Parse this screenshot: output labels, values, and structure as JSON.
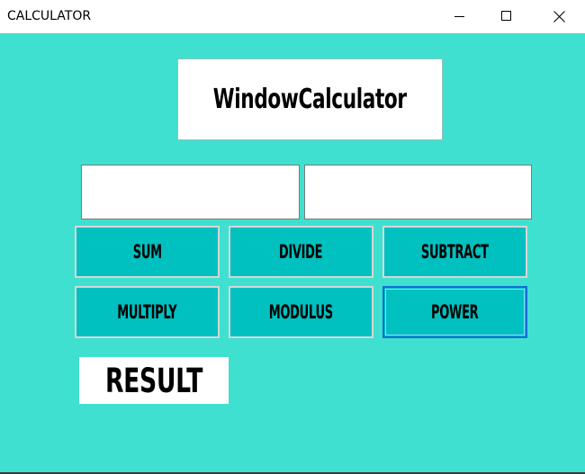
{
  "window": {
    "title": "CALCULATOR",
    "controls": [
      "minimize-icon",
      "maximize-icon",
      "close-icon"
    ]
  },
  "colors": {
    "client_background": "#40e0d0",
    "button_background": "#00c0c0",
    "button_border": "#d6d6d6",
    "focus_border": "#0f6fd6"
  },
  "heading": {
    "text": "WindowCalculator"
  },
  "inputs": [
    {
      "value": "",
      "placeholder": ""
    },
    {
      "value": "",
      "placeholder": ""
    }
  ],
  "buttons": {
    "sum": "SUM",
    "divide": "DIVIDE",
    "subtract": "SUBTRACT",
    "multiply": "MULTIPLY",
    "modulus": "MODULUS",
    "power": "POWER"
  },
  "focused_button": "power",
  "result": {
    "text": "RESULT"
  }
}
